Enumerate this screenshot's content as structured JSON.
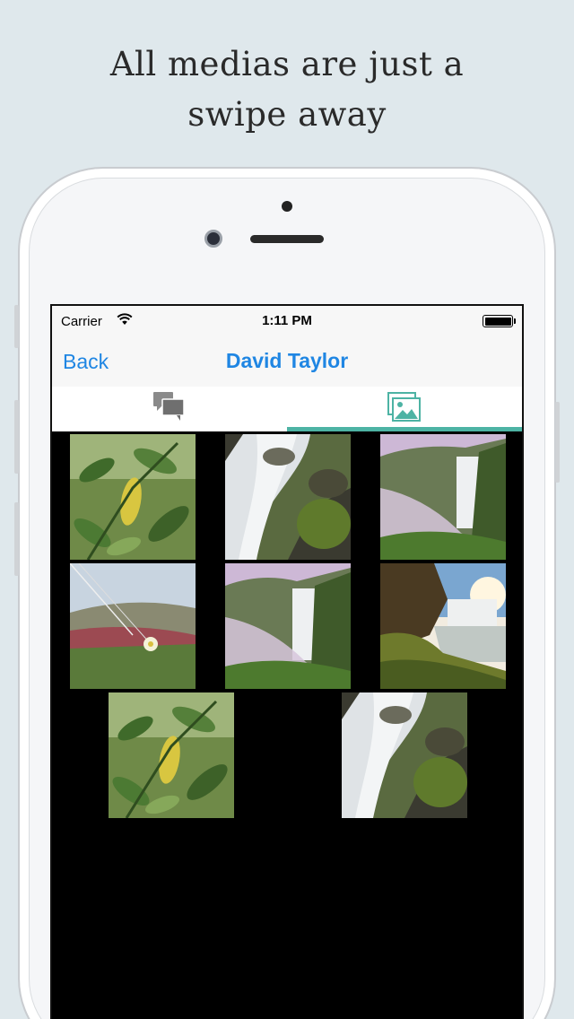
{
  "headline": "All medias are just a swipe away",
  "status_bar": {
    "carrier": "Carrier",
    "time": "1:11 PM"
  },
  "nav": {
    "back_label": "Back",
    "title": "David Taylor"
  },
  "tabs": [
    {
      "icon": "chat-bubbles-icon",
      "active": false
    },
    {
      "icon": "images-icon",
      "active": true
    }
  ],
  "colors": {
    "accent": "#4db3a4",
    "link": "#1f86e3",
    "background": "#dfe8ec"
  },
  "gallery": {
    "items": [
      {
        "subject": "leaves-with-yellow-leaf"
      },
      {
        "subject": "waterfall-closeup"
      },
      {
        "subject": "waterfall-misty-cliff"
      },
      {
        "subject": "grass-with-white-flower"
      },
      {
        "subject": "waterfall-misty-cliff"
      },
      {
        "subject": "waterfall-sunset"
      },
      {
        "subject": "leaves-with-yellow-leaf"
      },
      {
        "subject": "waterfall-closeup"
      }
    ]
  }
}
